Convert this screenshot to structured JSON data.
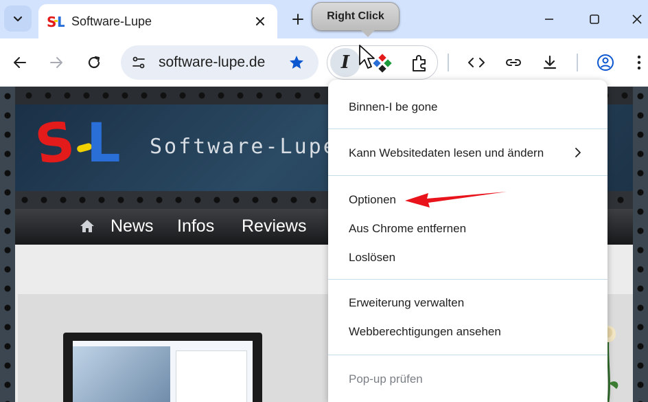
{
  "tab": {
    "title": "Software-Lupe"
  },
  "omnibox": {
    "url": "software-lupe.de"
  },
  "extension": {
    "glyph": "I"
  },
  "tooltip": {
    "label": "Right Click"
  },
  "website": {
    "brand": "Software-Lupe",
    "nav": [
      "News",
      "Infos",
      "Reviews"
    ]
  },
  "context_menu": {
    "items": [
      {
        "label": "Binnen-I be gone"
      },
      {
        "label": "Kann Websitedaten lesen und ändern"
      },
      {
        "label": "Optionen"
      },
      {
        "label": "Aus Chrome entfernen"
      },
      {
        "label": "Loslösen"
      },
      {
        "label": "Erweiterung verwalten"
      },
      {
        "label": "Webberechtigungen ansehen"
      },
      {
        "label": "Pop-up prüfen"
      }
    ]
  },
  "colors": {
    "tabstrip": "#d3e3fd",
    "accent_star": "#0b57d0",
    "annotation_arrow": "#e8131b",
    "logo_red": "#e31b1b",
    "logo_yellow": "#f1d100",
    "logo_blue": "#2a6fd8"
  },
  "icons": {
    "tab_search": "chevron-down-icon",
    "tab_close": "close-icon",
    "new_tab": "plus-icon",
    "minimize": "minimize-icon",
    "maximize": "maximize-icon",
    "window_close": "close-icon",
    "back": "arrow-left-icon",
    "forward": "arrow-right-icon",
    "reload": "reload-icon",
    "site_info": "tune-icon",
    "bookmark": "star-icon",
    "extensions": "puzzle-icon",
    "code": "code-icon",
    "link": "link-icon",
    "download": "download-icon",
    "profile": "account-circle-icon",
    "menu": "more-vert-icon",
    "submenu": "chevron-right-icon",
    "home": "home-icon"
  }
}
